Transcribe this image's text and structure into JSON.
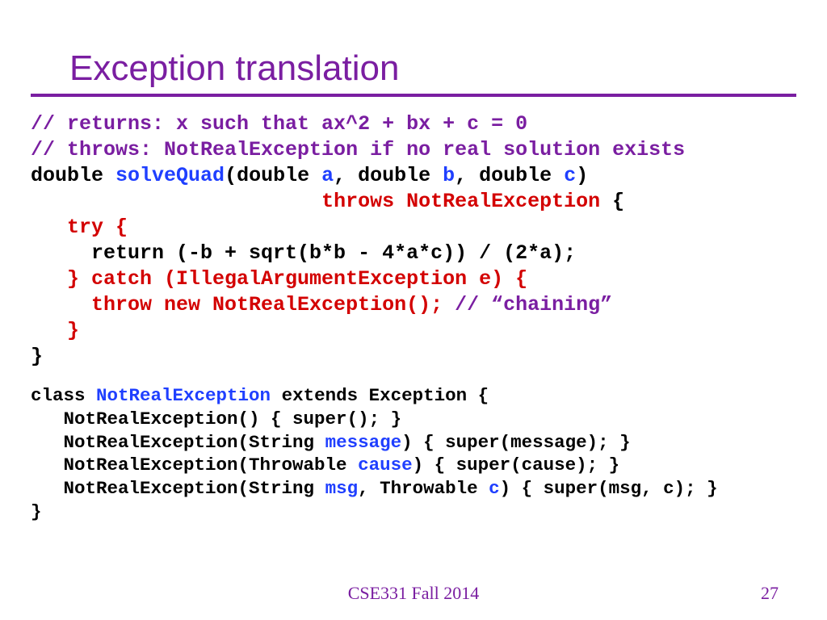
{
  "title": "Exception translation",
  "footer": "CSE331 Fall 2014",
  "page_number": "27",
  "code1": {
    "l1": "// returns: x such that ax^2 + bx + c = 0",
    "l2": "// throws: NotRealException if no real solution exists",
    "l3_a": "double ",
    "l3_b": "solveQuad",
    "l3_c": "(double ",
    "l3_d": "a",
    "l3_e": ", double ",
    "l3_f": "b",
    "l3_g": ", double ",
    "l3_h": "c",
    "l3_i": ")",
    "l4_pad": "                        ",
    "l4_a": "throws NotRealException",
    "l4_b": " {",
    "l5": "   try {",
    "l6": "     return (-b + sqrt(b*b - 4*a*c)) / (2*a);",
    "l7": "   } catch (IllegalArgumentException e) {",
    "l8_a": "     throw new NotRealException();",
    "l8_b": " // “chaining”",
    "l9": "   }",
    "l10": "}"
  },
  "code2": {
    "l1_a": "class ",
    "l1_b": "NotRealException",
    "l1_c": " extends Exception {",
    "l2": "   NotRealException() { super(); }",
    "l3_a": "   NotRealException(String ",
    "l3_b": "message",
    "l3_c": ") { super(message); }",
    "l4_a": "   NotRealException(Throwable ",
    "l4_b": "cause",
    "l4_c": ") { super(cause); }",
    "l5_a": "   NotRealException(String ",
    "l5_b": "msg",
    "l5_c": ", Throwable ",
    "l5_d": "c",
    "l5_e": ") { super(msg, c); }",
    "l6": "}"
  }
}
